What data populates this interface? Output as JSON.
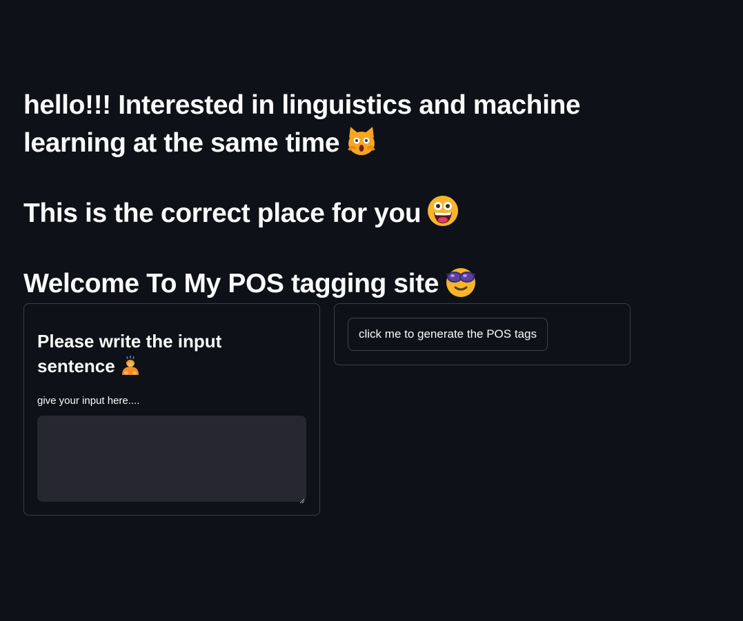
{
  "hero": {
    "line1": "hello!!! Interested in linguistics and machine learning at the same time",
    "line1_icon": "scream-cat-icon",
    "line2": "This is the correct place for you",
    "line2_icon": "grinning-face-icon",
    "line3": "Welcome To My POS tagging site",
    "line3_icon": "sunglasses-face-icon"
  },
  "input_card": {
    "title": "Please write the input sentence",
    "title_icon": "person-bowing-icon",
    "label": "give your input here....",
    "value": ""
  },
  "action_card": {
    "button_label": "click me to generate the POS tags"
  },
  "colors": {
    "background": "#0e1117",
    "text": "#fafafa",
    "input_bg": "#262730",
    "border": "rgba(250,250,250,0.2)"
  }
}
